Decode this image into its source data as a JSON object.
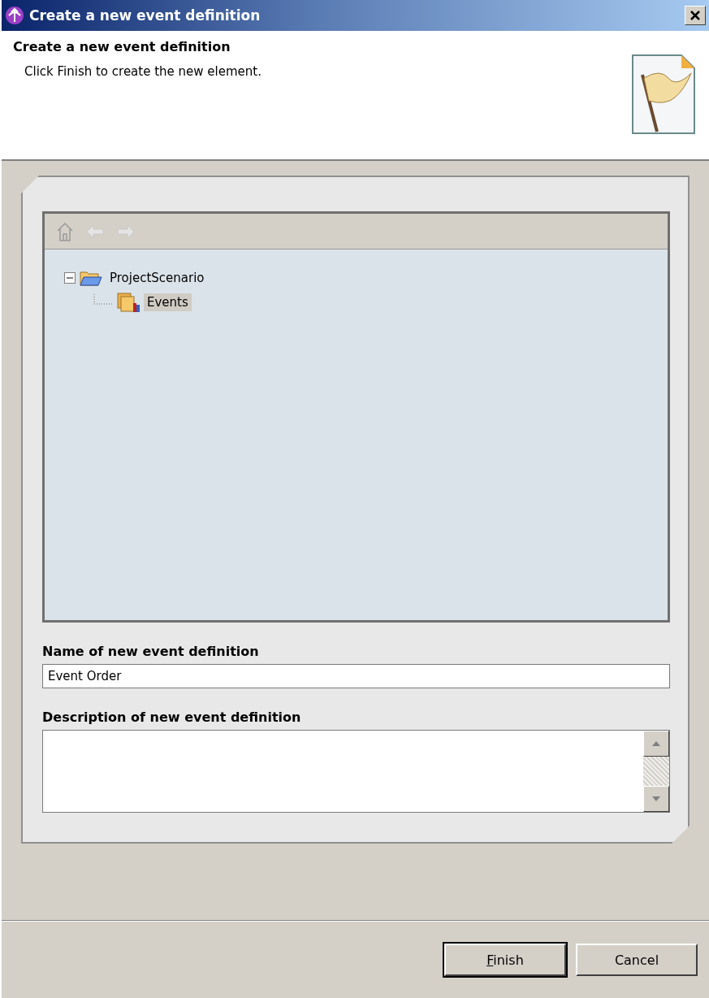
{
  "window": {
    "title": "Create a new event definition"
  },
  "banner": {
    "title": "Create a new event definition",
    "message": "Click Finish to create the new element."
  },
  "tree": {
    "items": [
      {
        "label": "ProjectScenario",
        "kind": "project",
        "expanded": true,
        "selected": false,
        "children": [
          {
            "label": "Events",
            "kind": "events",
            "selected": true
          }
        ]
      }
    ]
  },
  "name_field": {
    "label": "Name of new event definition",
    "value": "Event Order"
  },
  "description_field": {
    "label": "Description of new event definition"
  },
  "buttons": [
    {
      "label": "Finish",
      "mnemonic_underlined": true,
      "default": true
    },
    {
      "label": "Cancel",
      "default": false
    }
  ]
}
